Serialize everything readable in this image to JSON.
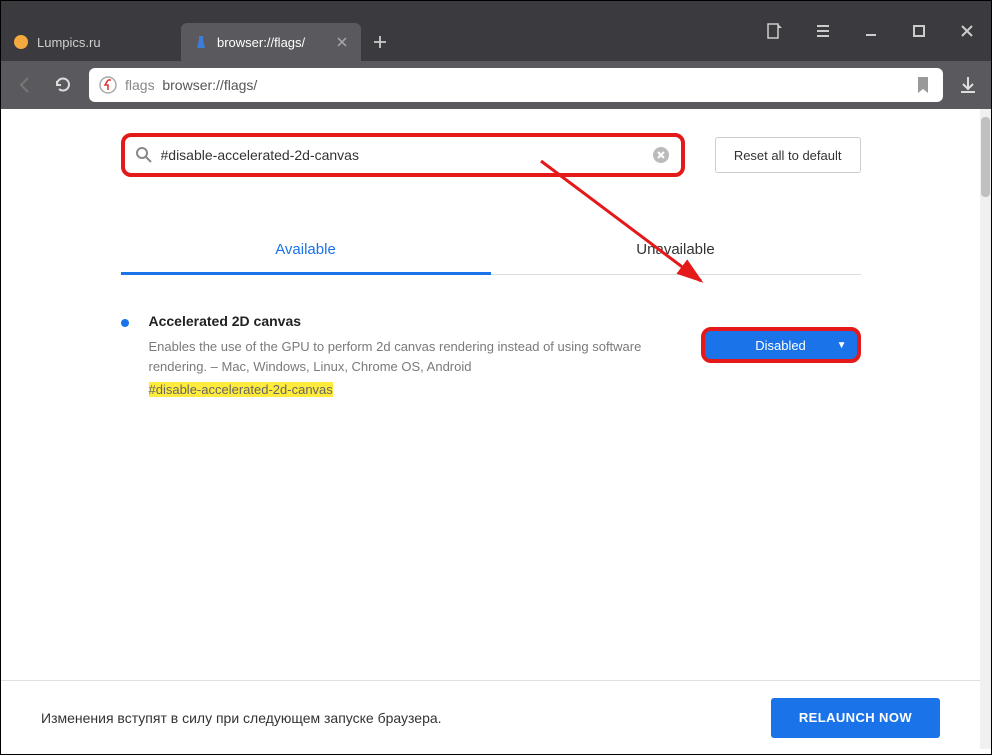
{
  "window": {
    "tabs": [
      {
        "title": "Lumpics.ru",
        "active": false
      },
      {
        "title": "browser://flags/",
        "active": true
      }
    ]
  },
  "addressbar": {
    "prefix": "flags",
    "url": "browser://flags/"
  },
  "flagspage": {
    "search_value": "#disable-accelerated-2d-canvas",
    "reset_label": "Reset all to default",
    "tabs": {
      "available": "Available",
      "unavailable": "Unavailable"
    },
    "flag": {
      "title": "Accelerated 2D canvas",
      "description": "Enables the use of the GPU to perform 2d canvas rendering instead of using software rendering. – Mac, Windows, Linux, Chrome OS, Android",
      "hash": "#disable-accelerated-2d-canvas",
      "state": "Disabled"
    }
  },
  "footer": {
    "message": "Изменения вступят в силу при следующем запуске браузера.",
    "relaunch": "RELAUNCH NOW"
  }
}
